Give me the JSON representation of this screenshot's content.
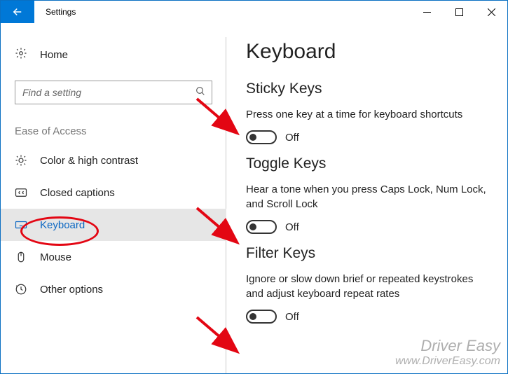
{
  "titlebar": {
    "app_name": "Settings"
  },
  "sidebar": {
    "home_label": "Home",
    "search_placeholder": "Find a setting",
    "category_label": "Ease of Access",
    "items": [
      {
        "label": "Color & high contrast"
      },
      {
        "label": "Closed captions"
      },
      {
        "label": "Keyboard"
      },
      {
        "label": "Mouse"
      },
      {
        "label": "Other options"
      }
    ]
  },
  "content": {
    "page_title": "Keyboard",
    "sections": [
      {
        "title": "Sticky Keys",
        "desc": "Press one key at a time for keyboard shortcuts",
        "state": "Off"
      },
      {
        "title": "Toggle Keys",
        "desc": "Hear a tone when you press Caps Lock, Num Lock, and Scroll Lock",
        "state": "Off"
      },
      {
        "title": "Filter Keys",
        "desc": "Ignore or slow down brief or repeated keystrokes and adjust keyboard repeat rates",
        "state": "Off"
      }
    ]
  },
  "watermark": {
    "line1": "Driver Easy",
    "line2": "www.DriverEasy.com"
  }
}
